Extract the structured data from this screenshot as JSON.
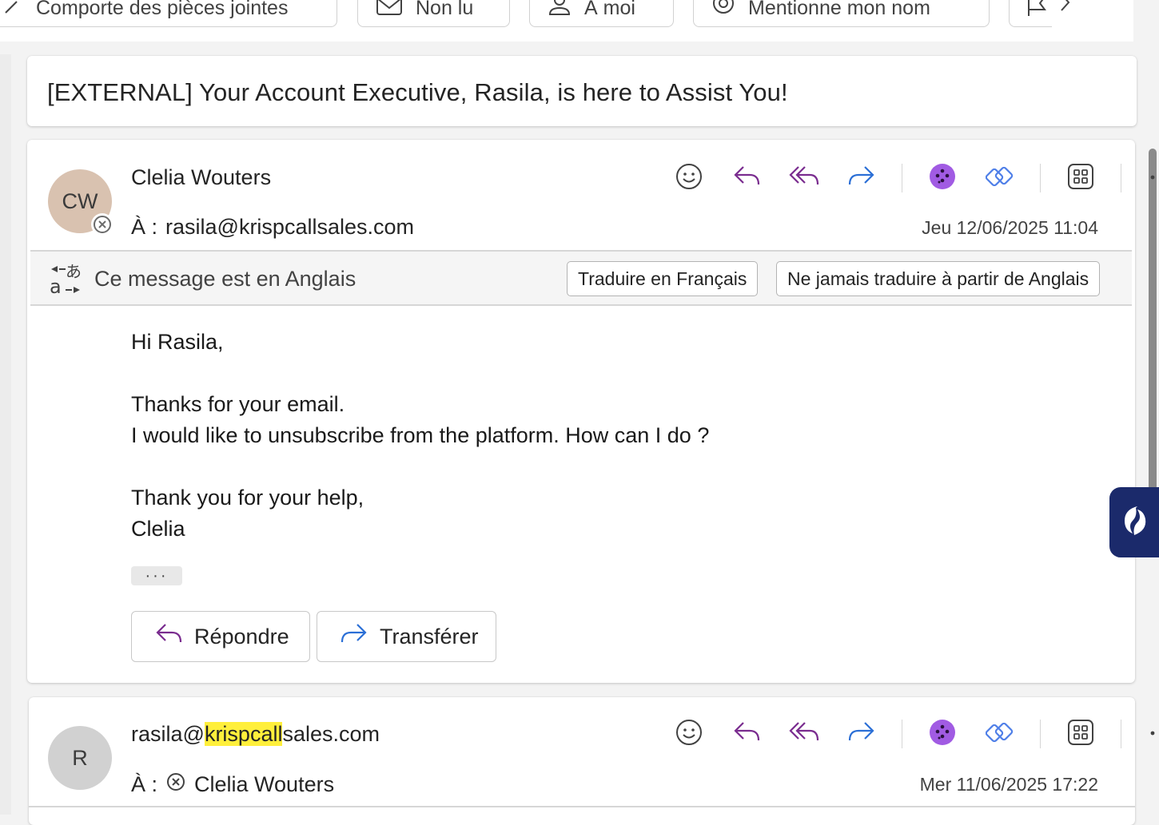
{
  "filters": {
    "chips": [
      {
        "label": "Comporte des pièces jointes",
        "icon": "paperclip-icon"
      },
      {
        "label": "Non lu",
        "icon": "envelope-icon"
      },
      {
        "label": "À moi",
        "icon": "person-icon"
      },
      {
        "label": "Mentionne mon nom",
        "icon": "at-icon"
      },
      {
        "label": "",
        "icon": "flag-icon"
      }
    ]
  },
  "subject": "[EXTERNAL] Your Account Executive, Rasila, is here to Assist You!",
  "message1": {
    "avatar_initials": "CW",
    "avatar_color": "#d9c2b0",
    "sender": "Clelia Wouters",
    "to_label": "À :",
    "to": "rasila@krispcallsales.com",
    "date": "Jeu 12/06/2025 11:04",
    "translation": {
      "text": "Ce message est en Anglais",
      "translate_button": "Traduire en Français",
      "never_button": "Ne jamais traduire à partir de Anglais"
    },
    "body": {
      "greeting": "Hi Rasila,",
      "line1": "Thanks for your email.",
      "line2": "I would like to unsubscribe from the platform. How can I do ?",
      "closing": "Thank you for your help,",
      "signature": "Clelia"
    },
    "ellipsis": "···",
    "reply_button": "Répondre",
    "forward_button": "Transférer"
  },
  "message2": {
    "avatar_initials": "R",
    "avatar_color": "#d1d1d1",
    "sender_pre": "rasila@",
    "sender_highlight": "krispcall",
    "sender_post": "sales.com",
    "to_label": "À :",
    "to": "Clelia Wouters",
    "date": "Mer 11/06/2025 17:22"
  },
  "colors": {
    "reply_purple": "#7a2c8f",
    "forward_blue": "#2b6fd6",
    "copilot_purple": "#a15be3",
    "loop_blue": "#4f7fe8",
    "highlight": "#ffef3b"
  }
}
